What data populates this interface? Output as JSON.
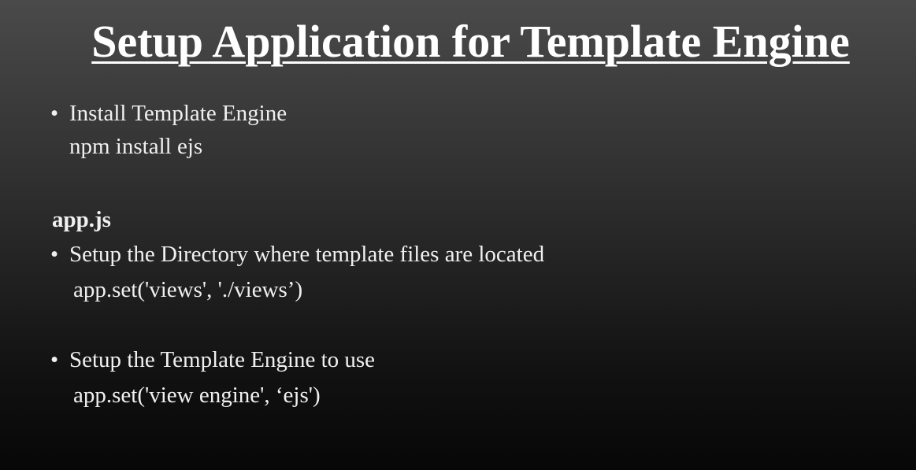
{
  "slide": {
    "title": "Setup Application for Template Engine",
    "bullets": [
      {
        "text": "Install Template Engine",
        "code": "npm install ejs"
      }
    ],
    "section_heading": "app.js",
    "section_bullets": [
      {
        "text": "Setup the Directory where template files are located",
        "code": "app.set('views', './views’)"
      },
      {
        "text": "Setup the Template Engine to use",
        "code": "app.set('view engine', ‘ejs')"
      }
    ],
    "bullet_glyph": "•"
  }
}
